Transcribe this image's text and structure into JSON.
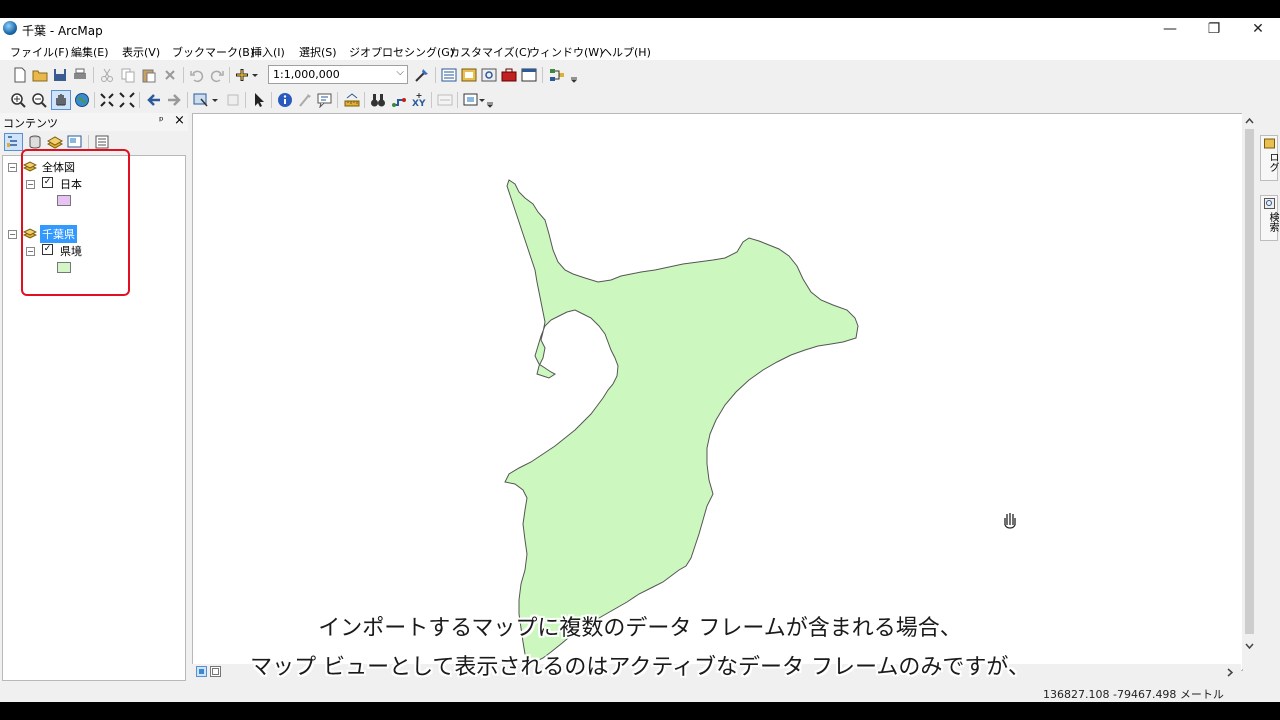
{
  "window": {
    "title": "千葉 - ArcMap",
    "minimize_glyph": "—",
    "restore_glyph": "❐",
    "close_glyph": "✕"
  },
  "menu": [
    "ファイル(F)",
    "編集(E)",
    "表示(V)",
    "ブックマーク(B)",
    "挿入(I)",
    "選択(S)",
    "ジオプロセシング(G)",
    "カスタマイズ(C)",
    "ウィンドウ(W)",
    "ヘルプ(H)"
  ],
  "toolbar": {
    "scale_value": "1:1,000,000",
    "scale_arrow": "⌵"
  },
  "toc": {
    "title": "コンテンツ",
    "pin_glyph": "ᵖ",
    "close_glyph": "×",
    "expand_glyph": "−",
    "check_glyph": "✓",
    "frames": [
      {
        "name": "全体図",
        "layer": "日本",
        "color": "#e6c3f2"
      },
      {
        "name": "千葉県",
        "layer": "県境",
        "color": "#d4f5c8"
      }
    ]
  },
  "map": {
    "fill_color": "#ccf8c0",
    "outline_color": "#555555"
  },
  "dock": {
    "catalog_label": "カタログ",
    "search_label": "検索"
  },
  "status": {
    "coords": "136827.108  -79467.498 メートル"
  },
  "subtitles": {
    "line1": "インポートするマップに複数のデータ フレームが含まれる場合、",
    "line2": "マップ ビューとして表示されるのはアクティブなデータ フレームのみですが、"
  }
}
